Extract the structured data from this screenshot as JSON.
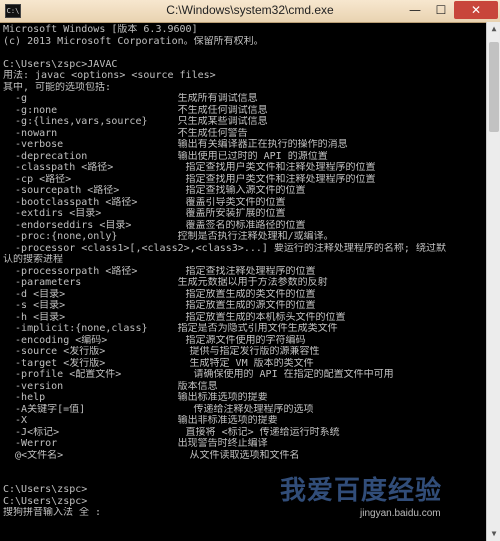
{
  "window": {
    "title": "C:\\Windows\\system32\\cmd.exe",
    "icon_label": "C:\\",
    "minimize_glyph": "—",
    "maximize_glyph": "☐",
    "close_glyph": "✕"
  },
  "console": {
    "lines": [
      "Microsoft Windows [版本 6.3.9600]",
      "(c) 2013 Microsoft Corporation。保留所有权利。",
      "",
      "C:\\Users\\zspc>JAVAC",
      "用法: javac <options> <source files>",
      "其中, 可能的选项包括:",
      "  -g                         生成所有调试信息",
      "  -g:none                    不生成任何调试信息",
      "  -g:{lines,vars,source}     只生成某些调试信息",
      "  -nowarn                    不生成任何警告",
      "  -verbose                   输出有关编译器正在执行的操作的消息",
      "  -deprecation               输出使用已过时的 API 的源位置",
      "  -classpath <路径>            指定查找用户类文件和注释处理程序的位置",
      "  -cp <路径>                   指定查找用户类文件和注释处理程序的位置",
      "  -sourcepath <路径>           指定查找输入源文件的位置",
      "  -bootclasspath <路径>        覆盖引导类文件的位置",
      "  -extdirs <目录>              覆盖所安装扩展的位置",
      "  -endorseddirs <目录>         覆盖签名的标准路径的位置",
      "  -proc:{none,only}          控制是否执行注释处理和/或编译。",
      "  -processor <class1>[,<class2>,<class3>...] 要运行的注释处理程序的名称; 绕过默",
      "认的搜索进程",
      "  -processorpath <路径>        指定查找注释处理程序的位置",
      "  -parameters                生成元数据以用于方法参数的反射",
      "  -d <目录>                    指定放置生成的类文件的位置",
      "  -s <目录>                    指定放置生成的源文件的位置",
      "  -h <目录>                    指定放置生成的本机标头文件的位置",
      "  -implicit:{none,class}     指定是否为隐式引用文件生成类文件",
      "  -encoding <编码>             指定源文件使用的字符编码",
      "  -source <发行版>              提供与指定发行版的源兼容性",
      "  -target <发行版>              生成特定 VM 版本的类文件",
      "  -profile <配置文件>            请确保使用的 API 在指定的配置文件中可用",
      "  -version                   版本信息",
      "  -help                      输出标准选项的提要",
      "  -A关键字[=值]                  传递给注释处理程序的选项",
      "  -X                         输出非标准选项的提要",
      "  -J<标记>                     直接将 <标记> 传递给运行时系统",
      "  -Werror                    出现警告时终止编译",
      "  @<文件名>                     从文件读取选项和文件名",
      "",
      "",
      "C:\\Users\\zspc>",
      "C:\\Users\\zspc>",
      "搜狗拼音输入法 全 :"
    ]
  },
  "watermark": {
    "logo_text": "我爱百度经验",
    "url": "jingyan.baidu.com"
  },
  "colors": {
    "console_bg": "#000000",
    "console_fg": "#c0c0c0",
    "title_bg": "#f2dfc2",
    "close_bg": "#c8463b"
  }
}
